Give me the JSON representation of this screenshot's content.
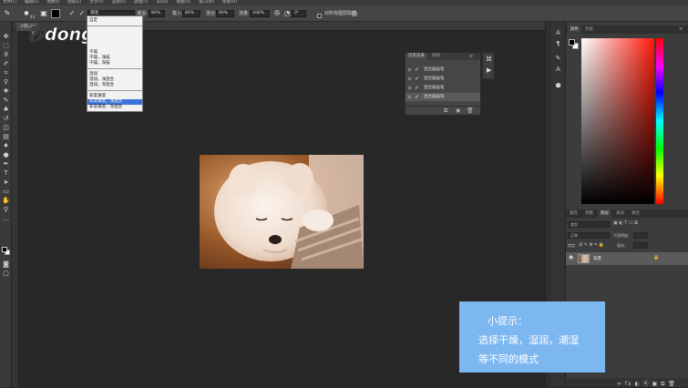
{
  "menubar": {
    "items": [
      "文件(F)",
      "编辑(E)",
      "图像(I)",
      "图层(L)",
      "文字(Y)",
      "选择(S)",
      "滤镜(T)",
      "3D(D)",
      "视图(V)",
      "窗口(W)",
      "帮助(H)"
    ]
  },
  "options": {
    "brush_size": "43",
    "mode_label": "模式:",
    "mode_value": "潮湿",
    "wet_label": "潮湿:",
    "wet_value": "80%",
    "load_label": "载入:",
    "load_value": "80%",
    "mix_label": "混合:",
    "mix_value": "90%",
    "flow_label": "流量:",
    "flow_value": "100%",
    "angle_value": "0°",
    "sample_label": "对所有图层取样"
  },
  "document_tab": "小狗.jpg",
  "mode_dropdown": {
    "items": [
      "自定",
      "干燥",
      "干燥，浅描",
      "干燥，深描",
      "湿润",
      "湿润，浅混合",
      "湿润，深混合",
      "非常潮湿",
      "非常潮湿，浅混合",
      "非常潮湿，深混合"
    ],
    "selected_index": 8
  },
  "logo": {
    "text": "秒dong视频"
  },
  "history_panel": {
    "tabs": [
      "历史记录",
      "动作"
    ],
    "rows": [
      "混合器画笔",
      "混合器画笔",
      "混合器画笔",
      "混合器画笔"
    ],
    "selected_index": 3
  },
  "color_panel": {
    "tabs": [
      "颜色",
      "色板"
    ],
    "hue_color": "#ff1a0a"
  },
  "layers_panel": {
    "tabs": [
      "属性",
      "调整",
      "图层",
      "通道",
      "路径"
    ],
    "kind_filter": "类型",
    "blend_mode": "正常",
    "opacity_label": "不透明度:",
    "lock_label": "锁定:",
    "fill_label": "填充:",
    "layer_name": "背景"
  },
  "tip": {
    "title": "小提示：",
    "line1": "选择干燥，湿润，潮湿",
    "line2": "等不同的模式",
    "background": "#7db7ef"
  }
}
